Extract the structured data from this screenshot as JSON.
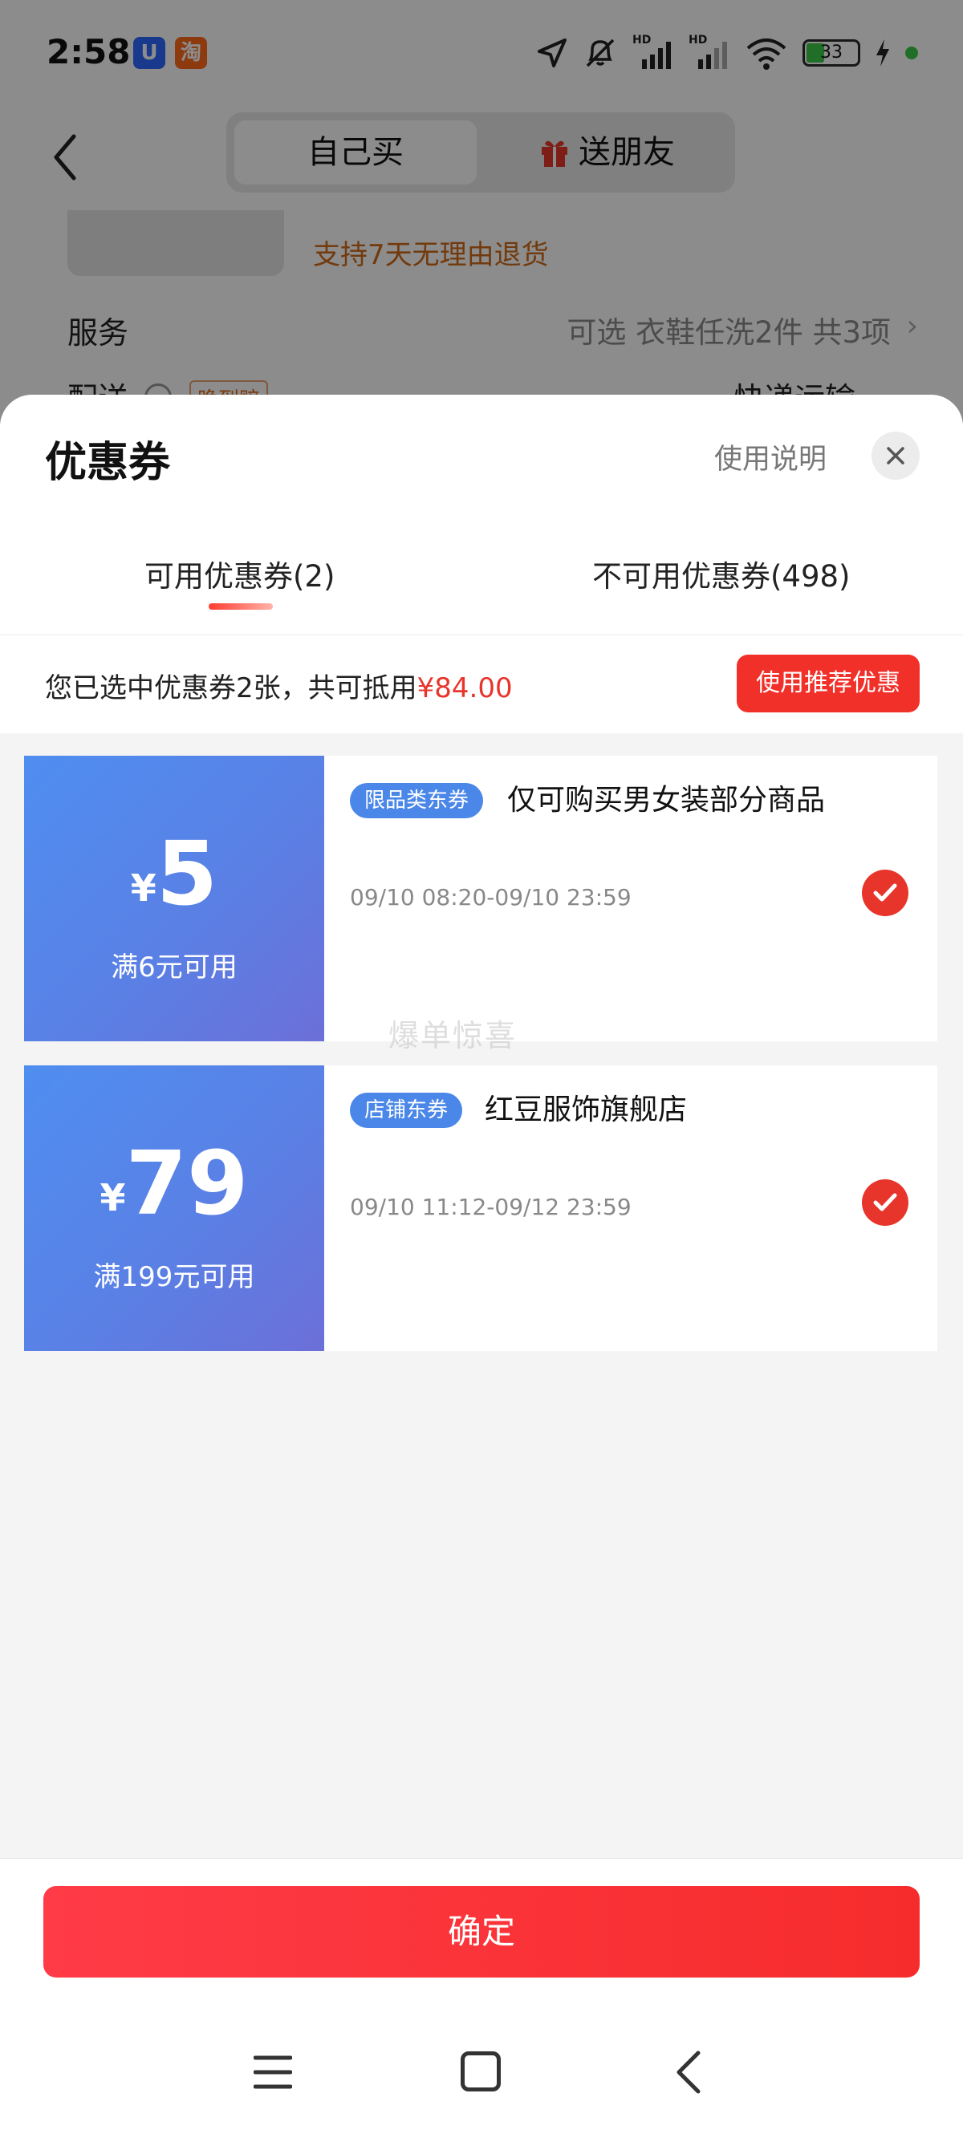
{
  "status_bar": {
    "time": "2:58",
    "app_badge_1": "U",
    "app_badge_2": "淘",
    "battery": "33",
    "signal_label_1": "HD",
    "signal_label_2": "HD"
  },
  "nav": {
    "segment_self": "自己买",
    "segment_gift": "送朋友"
  },
  "background_page": {
    "return_policy": "支持7天无理由退货",
    "service_label": "服务",
    "service_value": "可选 衣鞋任洗2件 共3项",
    "service_chevron": "›",
    "delivery_label": "配送",
    "delivery_tag": "晚到赔",
    "delivery_value": "快递运输"
  },
  "sheet": {
    "title": "优惠券",
    "instructions": "使用说明",
    "tabs": [
      {
        "label": "可用优惠券(2)"
      },
      {
        "label": "不可用优惠券(498)"
      }
    ],
    "summary": {
      "prefix": "您已选中优惠券2张，共可抵用",
      "amount": "¥84.00"
    },
    "recommend_button": "使用推荐优惠",
    "coupons": [
      {
        "currency": "¥",
        "amount": "5",
        "threshold": "满6元可用",
        "tag": "限品类东券",
        "description": "仅可购买男女装部分商品",
        "validity": "09/10 08:20-09/10 23:59",
        "selected": true
      },
      {
        "currency": "¥",
        "amount": "79",
        "threshold": "满199元可用",
        "tag": "店铺东券",
        "description": "红豆服饰旗舰店",
        "validity": "09/10 11:12-09/12 23:59",
        "selected": true
      }
    ],
    "watermark": "爆单惊喜",
    "confirm_button": "确定"
  },
  "colors": {
    "accent_red": "#e8352b",
    "coupon_blue": "#5b7fe4",
    "tag_blue": "#4a87e8",
    "return_orange": "#d06a18"
  },
  "icons": [
    "back-arrow-icon",
    "gift-icon",
    "location-icon",
    "mute-icon",
    "signal-icon",
    "wifi-icon",
    "battery-icon",
    "charging-icon",
    "close-icon",
    "info-icon",
    "check-icon",
    "menu-icon",
    "home-icon",
    "back-icon"
  ]
}
